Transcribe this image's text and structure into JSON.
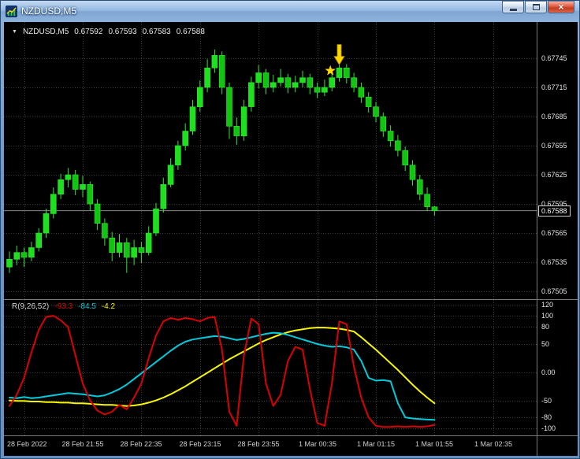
{
  "window": {
    "title": "NZDUSD,M5",
    "close_glyph": "×"
  },
  "symbol_line": {
    "expander": "▼",
    "symbol": "NZDUSD,M5",
    "open": "0.67592",
    "high": "0.67593",
    "low": "0.67583",
    "close": "0.67588"
  },
  "indicator": {
    "name": "R(9,26,52)",
    "value1": "-93.3",
    "value2": "-84.5",
    "value3": "-4.2"
  },
  "price_axis": {
    "labels": [
      "0.67745",
      "0.67715",
      "0.67685",
      "0.67655",
      "0.67625",
      "0.67595",
      "0.67565",
      "0.67535",
      "0.67505"
    ],
    "values": [
      0.67745,
      0.67715,
      0.67685,
      0.67655,
      0.67625,
      0.67595,
      0.67565,
      0.67535,
      0.67505
    ],
    "current_label": "0.67588"
  },
  "indicator_axis": {
    "labels": [
      "120",
      "100",
      "80",
      "50",
      "0.00",
      "-50",
      "-80",
      "-100"
    ],
    "values": [
      120,
      100,
      80,
      50,
      0,
      -50,
      -80,
      -100
    ]
  },
  "time_axis": {
    "labels": [
      "28 Feb 2022",
      "28 Feb 21:55",
      "28 Feb 22:35",
      "28 Feb 23:15",
      "28 Feb 23:55",
      "1 Mar 00:35",
      "1 Mar 01:15",
      "1 Mar 01:55",
      "1 Mar 02:35"
    ],
    "tick_candle_indices": [
      2,
      10,
      18,
      26,
      34,
      42,
      50,
      58,
      66
    ]
  },
  "colors": {
    "background": "#000000",
    "grid": "#3a3a3a",
    "candle_up": "#1ee01e",
    "candle_down": "#12c312",
    "candle_outline": "#2be82b",
    "series_red": "#dd0000",
    "series_cyan": "#00ccdd",
    "series_yellow": "#f8f800",
    "marker": "#ffd700",
    "current_price_line": "#8a8a8a",
    "axis_text": "#e4e4e4",
    "separator": "#7a7a7a"
  },
  "chart_data": [
    {
      "type": "candlestick",
      "symbol": "NZDUSD",
      "timeframe": "M5",
      "current_price": 0.67588,
      "ylim": [
        0.67497,
        0.67782
      ],
      "grid_prices": [
        0.67745,
        0.67715,
        0.67685,
        0.67655,
        0.67625,
        0.67595,
        0.67565,
        0.67535,
        0.67505
      ],
      "markers": [
        {
          "type": "star",
          "candle": 44
        },
        {
          "type": "arrow-down",
          "candle": 45
        }
      ],
      "candles": [
        [
          0.6753,
          0.67546,
          0.67524,
          0.67538
        ],
        [
          0.67538,
          0.67552,
          0.67532,
          0.67545
        ],
        [
          0.67545,
          0.6755,
          0.6753,
          0.6754
        ],
        [
          0.6754,
          0.67556,
          0.67536,
          0.6755
        ],
        [
          0.6755,
          0.6757,
          0.67546,
          0.67565
        ],
        [
          0.67565,
          0.6759,
          0.6756,
          0.67585
        ],
        [
          0.67585,
          0.67612,
          0.6758,
          0.67605
        ],
        [
          0.67605,
          0.67626,
          0.676,
          0.6762
        ],
        [
          0.6762,
          0.67632,
          0.67612,
          0.67625
        ],
        [
          0.67625,
          0.6763,
          0.67604,
          0.6761
        ],
        [
          0.6761,
          0.67624,
          0.67602,
          0.67615
        ],
        [
          0.67615,
          0.67618,
          0.67588,
          0.67595
        ],
        [
          0.67595,
          0.676,
          0.67568,
          0.67575
        ],
        [
          0.67575,
          0.6758,
          0.67552,
          0.6756
        ],
        [
          0.6756,
          0.67566,
          0.67536,
          0.67545
        ],
        [
          0.67545,
          0.67564,
          0.6754,
          0.67555
        ],
        [
          0.67555,
          0.6756,
          0.67524,
          0.6754
        ],
        [
          0.6754,
          0.67558,
          0.67532,
          0.6755
        ],
        [
          0.6755,
          0.67556,
          0.67534,
          0.67545
        ],
        [
          0.67545,
          0.67572,
          0.67542,
          0.67565
        ],
        [
          0.67565,
          0.67596,
          0.67562,
          0.6759
        ],
        [
          0.6759,
          0.67622,
          0.67586,
          0.67615
        ],
        [
          0.67615,
          0.67642,
          0.67612,
          0.67635
        ],
        [
          0.67635,
          0.6766,
          0.6763,
          0.67655
        ],
        [
          0.67655,
          0.67678,
          0.6765,
          0.6767
        ],
        [
          0.6767,
          0.67702,
          0.67666,
          0.67695
        ],
        [
          0.67695,
          0.67722,
          0.6769,
          0.67715
        ],
        [
          0.67715,
          0.67744,
          0.6771,
          0.67735
        ],
        [
          0.67735,
          0.67754,
          0.6773,
          0.67748
        ],
        [
          0.67748,
          0.67752,
          0.67708,
          0.67715
        ],
        [
          0.67715,
          0.6772,
          0.67662,
          0.67675
        ],
        [
          0.67675,
          0.67684,
          0.67656,
          0.67665
        ],
        [
          0.67665,
          0.67702,
          0.6766,
          0.67695
        ],
        [
          0.67695,
          0.67726,
          0.6769,
          0.6772
        ],
        [
          0.6772,
          0.67738,
          0.67714,
          0.6773
        ],
        [
          0.6773,
          0.67734,
          0.67708,
          0.67715
        ],
        [
          0.67715,
          0.67728,
          0.6771,
          0.6772
        ],
        [
          0.6772,
          0.67734,
          0.67716,
          0.67725
        ],
        [
          0.67725,
          0.67729,
          0.67709,
          0.67715
        ],
        [
          0.67715,
          0.67727,
          0.6771,
          0.6772
        ],
        [
          0.6772,
          0.67732,
          0.67715,
          0.67725
        ],
        [
          0.67725,
          0.67729,
          0.67708,
          0.67715
        ],
        [
          0.67715,
          0.6772,
          0.67704,
          0.6771
        ],
        [
          0.6771,
          0.67723,
          0.67706,
          0.67715
        ],
        [
          0.67715,
          0.67733,
          0.67711,
          0.67725
        ],
        [
          0.67725,
          0.67743,
          0.67721,
          0.67735
        ],
        [
          0.67735,
          0.67739,
          0.67719,
          0.67725
        ],
        [
          0.67725,
          0.6773,
          0.6771,
          0.67715
        ],
        [
          0.67715,
          0.6772,
          0.67699,
          0.67705
        ],
        [
          0.67705,
          0.6771,
          0.67689,
          0.67695
        ],
        [
          0.67695,
          0.677,
          0.67679,
          0.67685
        ],
        [
          0.67685,
          0.67689,
          0.67664,
          0.6767
        ],
        [
          0.6767,
          0.67676,
          0.67654,
          0.6766
        ],
        [
          0.6766,
          0.67666,
          0.67644,
          0.6765
        ],
        [
          0.6765,
          0.67654,
          0.67629,
          0.67635
        ],
        [
          0.67635,
          0.6764,
          0.67614,
          0.6762
        ],
        [
          0.6762,
          0.67625,
          0.67599,
          0.67605
        ],
        [
          0.67605,
          0.67612,
          0.67588,
          0.67592
        ],
        [
          0.67592,
          0.67593,
          0.67583,
          0.67588
        ]
      ]
    },
    {
      "type": "line",
      "title": "R(9,26,52)",
      "current_values": [
        -93.3,
        -84.5,
        -4.2
      ],
      "levels": [
        120,
        100,
        80,
        50,
        0,
        -50,
        -80,
        -100
      ],
      "ylim": [
        -112,
        128
      ],
      "series": [
        {
          "name": "R9",
          "color": "#dd0000",
          "values": [
            -60,
            -40,
            -10,
            35,
            75,
            98,
            100,
            92,
            80,
            30,
            -20,
            -50,
            -68,
            -75,
            -70,
            -58,
            -66,
            -45,
            -20,
            25,
            65,
            90,
            96,
            93,
            96,
            94,
            90,
            96,
            98,
            40,
            -70,
            -95,
            30,
            95,
            85,
            -20,
            -60,
            -40,
            20,
            45,
            40,
            -30,
            -90,
            -95,
            -20,
            90,
            85,
            10,
            -45,
            -80,
            -95,
            -97,
            -97,
            -96,
            -97,
            -96,
            -97,
            -96,
            -93.3
          ]
        },
        {
          "name": "R26",
          "color": "#00ccdd",
          "values": [
            -45,
            -46,
            -44,
            -46,
            -45,
            -43,
            -41,
            -39,
            -37,
            -38,
            -39,
            -41,
            -43,
            -41,
            -36,
            -30,
            -22,
            -12,
            -2,
            8,
            18,
            28,
            38,
            47,
            54,
            58,
            60,
            62,
            64,
            63,
            60,
            57,
            59,
            62,
            65,
            68,
            70,
            69,
            66,
            62,
            58,
            54,
            50,
            47,
            45,
            46,
            44,
            40,
            20,
            -10,
            -15,
            -14,
            -16,
            -55,
            -80,
            -82,
            -83,
            -84,
            -84.5
          ]
        },
        {
          "name": "R52",
          "color": "#f8f800",
          "values": [
            -50,
            -51,
            -51,
            -52,
            -52,
            -53,
            -53,
            -54,
            -54,
            -55,
            -55,
            -56,
            -57,
            -58,
            -58,
            -59,
            -60,
            -59,
            -57,
            -54,
            -50,
            -45,
            -39,
            -32,
            -25,
            -17,
            -9,
            -1,
            7,
            15,
            23,
            30,
            37,
            44,
            51,
            57,
            62,
            67,
            71,
            74,
            76,
            78,
            79,
            79,
            78,
            77,
            75,
            72,
            62,
            51,
            40,
            28,
            16,
            4,
            -9,
            -22,
            -34,
            -45,
            -55
          ]
        }
      ]
    }
  ]
}
